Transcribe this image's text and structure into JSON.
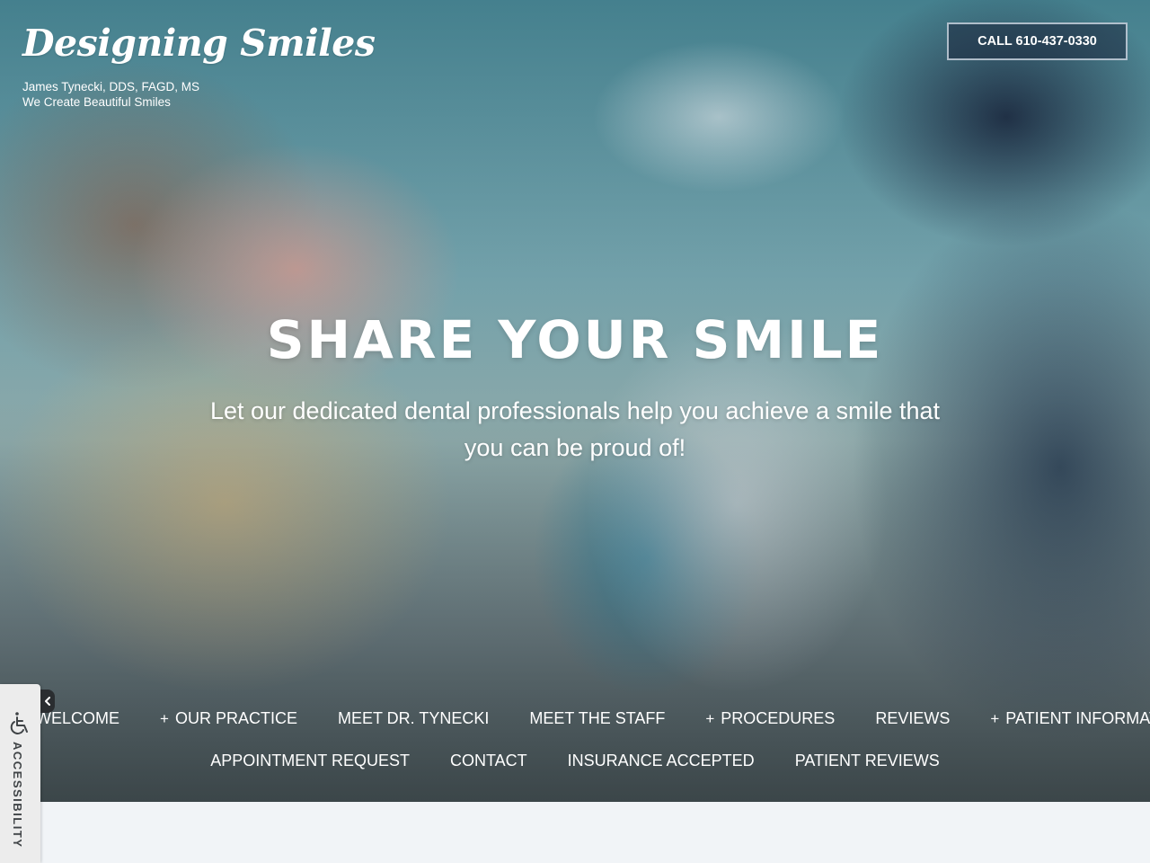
{
  "brand": {
    "logo_text": "Designing Smiles",
    "tagline_line1": "James Tynecki, DDS, FAGD, MS",
    "tagline_line2": "We Create Beautiful Smiles"
  },
  "header": {
    "call_button_label": "CALL 610-437-0330"
  },
  "hero": {
    "headline": "SHARE YOUR SMILE",
    "subhead": "Let our dedicated dental professionals help you achieve a smile that you can be proud of!"
  },
  "nav": {
    "row1": [
      {
        "label": "WELCOME",
        "has_submenu": false
      },
      {
        "label": "OUR PRACTICE",
        "has_submenu": true
      },
      {
        "label": "MEET DR. TYNECKI",
        "has_submenu": false
      },
      {
        "label": "MEET THE STAFF",
        "has_submenu": false
      },
      {
        "label": "PROCEDURES",
        "has_submenu": true
      },
      {
        "label": "REVIEWS",
        "has_submenu": false
      },
      {
        "label": "PATIENT INFORMATION",
        "has_submenu": true
      }
    ],
    "row2": [
      {
        "label": "APPOINTMENT REQUEST",
        "has_submenu": false
      },
      {
        "label": "CONTACT",
        "has_submenu": false
      },
      {
        "label": "INSURANCE ACCEPTED",
        "has_submenu": false
      },
      {
        "label": "PATIENT REVIEWS",
        "has_submenu": false
      }
    ],
    "submenu_marker": "+"
  },
  "accessibility": {
    "label": "ACCESSIBILITY",
    "icon": "wheelchair-icon",
    "toggle_icon": "chevron-left-icon"
  },
  "colors": {
    "text_on_hero": "#ffffff",
    "page_background": "#f1f4f7",
    "accessibility_tab_bg": "#ececec",
    "accessibility_text": "#3f4346",
    "toggle_bg": "#2a2d30"
  }
}
